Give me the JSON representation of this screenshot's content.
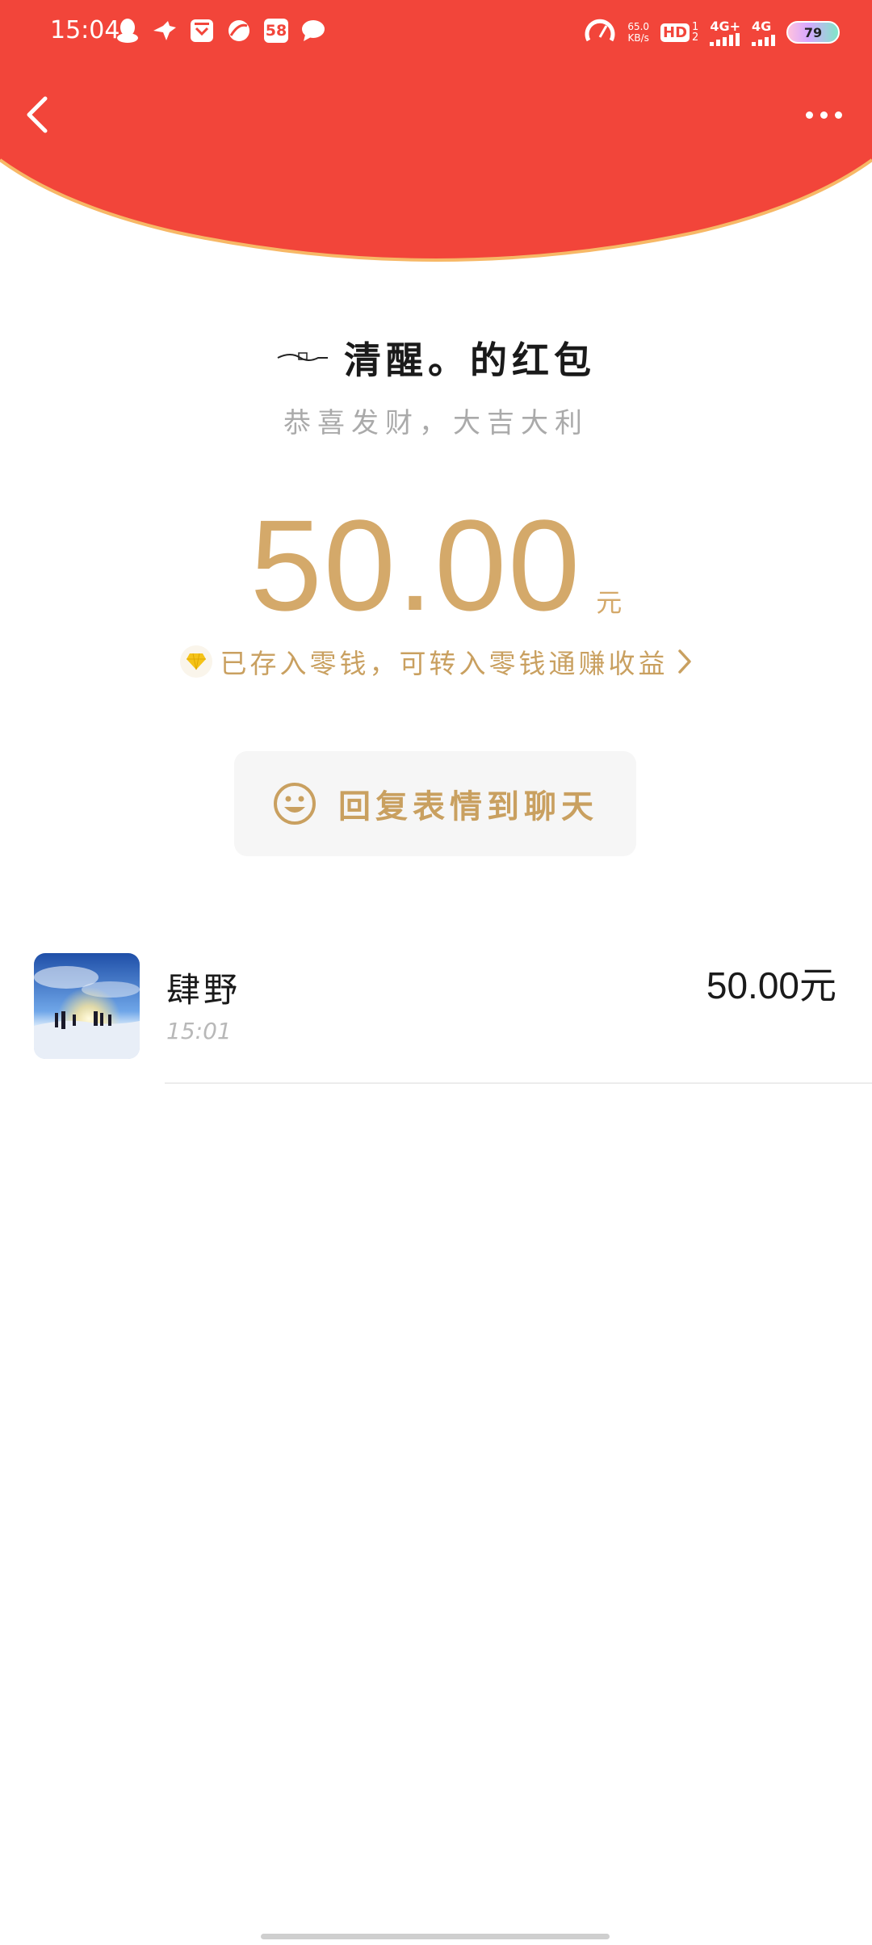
{
  "status_bar": {
    "time": "15:04",
    "net_speed_value": "65.0",
    "net_speed_unit": "KB/s",
    "hd_label": "HD",
    "hd_sub_top": "1",
    "hd_sub_bottom": "2",
    "sim1_label": "4G+",
    "sim2_label": "4G",
    "battery": "79",
    "app_badge_58": "58",
    "icons_left": [
      "qq-icon",
      "bird-icon",
      "calendar-icon",
      "browser-icon",
      "58-icon",
      "chat-bubble-icon"
    ]
  },
  "colors": {
    "header_red": "#f2453a",
    "header_edge": "#f7b866",
    "gold": "#d4a96a",
    "gold_text": "#c9a060"
  },
  "packet": {
    "title": "清醒。的红包",
    "subtitle": "恭喜发财，大吉大利",
    "amount": "50.00",
    "unit": "元",
    "note": "已存入零钱，可转入零钱通赚收益",
    "reply_button": "回复表情到聊天"
  },
  "receivers": [
    {
      "name": "肆野",
      "time": "15:01",
      "amount": "50.00元"
    }
  ]
}
